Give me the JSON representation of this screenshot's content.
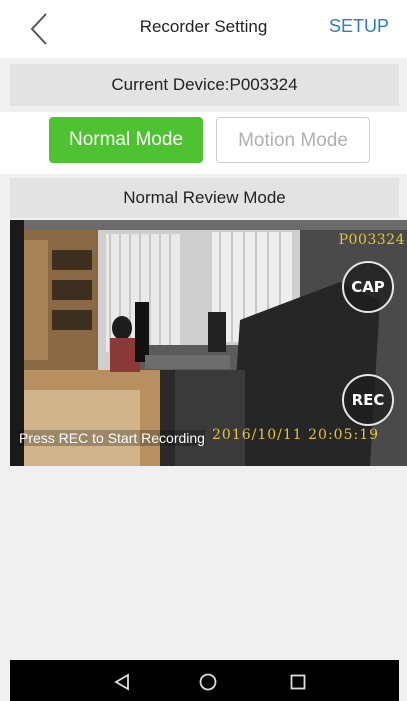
{
  "header": {
    "title": "Recorder Setting",
    "setup_label": "SETUP",
    "back_icon": "chevron-left-icon"
  },
  "device": {
    "label": "Current Device:P003324"
  },
  "modes": {
    "normal_label": "Normal Mode",
    "motion_label": "Motion Mode",
    "selected": "Normal Mode",
    "active_color": "#4fc231"
  },
  "review": {
    "label": "Normal Review Mode"
  },
  "video": {
    "camera_name": "P003324",
    "cap_label": "CAP",
    "rec_label": "REC",
    "hint": "Press REC to Start Recording",
    "timestamp": "2016/10/11  20:05:19",
    "overlay_color": "#e3c63a"
  },
  "nav": {
    "back_icon": "triangle-back-icon",
    "home_icon": "circle-home-icon",
    "recent_icon": "square-recent-icon"
  }
}
